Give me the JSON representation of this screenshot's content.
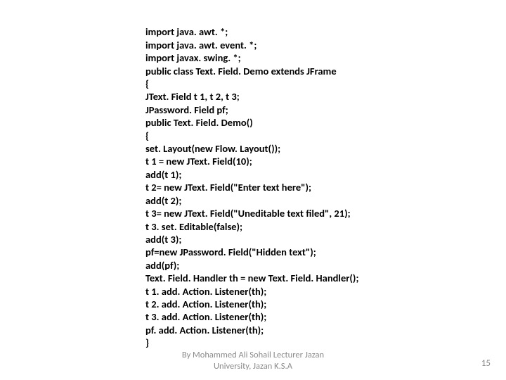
{
  "code": {
    "l1": "import java. awt. *;",
    "l2": "import java. awt. event. *;",
    "l3": "import javax. swing. *;",
    "l4": "public class Text. Field. Demo extends JFrame",
    "l5": "{",
    "l6": "JText. Field t 1, t 2, t 3;",
    "l7": "JPassword. Field pf;",
    "l8": "public Text. Field. Demo()",
    "l9": "{",
    "l10": "set. Layout(new Flow. Layout());",
    "l11": "t 1 = new JText. Field(10);",
    "l12": "add(t 1);",
    "l13": "t 2= new JText. Field(\"Enter text here\");",
    "l14": "add(t 2);",
    "l15": "t 3= new JText. Field(\"Uneditable text filed\", 21);",
    "l16": "t 3. set. Editable(false);",
    "l17": "add(t 3);",
    "l18": "pf=new JPassword. Field(\"Hidden text\");",
    "l19": "add(pf);",
    "l20": "Text. Field. Handler th = new Text. Field. Handler();",
    "l21": "t 1. add. Action. Listener(th);",
    "l22": "t 2. add. Action. Listener(th);",
    "l23": "t 3. add. Action. Listener(th);",
    "l24": "pf. add. Action. Listener(th);",
    "l25": "}"
  },
  "footer": {
    "attribution_line1": "By Mohammed Ali Sohail Lecturer Jazan",
    "attribution_line2": "University, Jazan K.S.A",
    "page_number": "15"
  }
}
